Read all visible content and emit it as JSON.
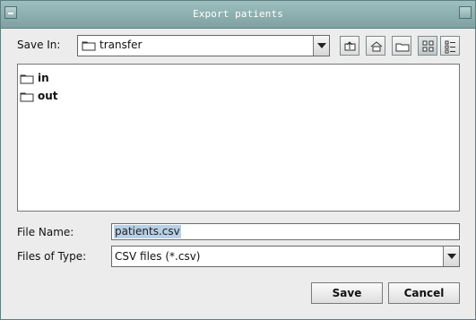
{
  "window": {
    "title": "Export patients"
  },
  "save_in": {
    "label": "Save In:",
    "value": "transfer",
    "icons": [
      "folder-icon",
      "up-one-level-icon",
      "home-icon",
      "new-folder-icon",
      "list-view-icon",
      "details-view-icon"
    ]
  },
  "file_list": [
    {
      "name": "in",
      "icon": "folder-icon"
    },
    {
      "name": "out",
      "icon": "folder-icon"
    }
  ],
  "file_name": {
    "label": "File Name:",
    "value": "patients.csv"
  },
  "files_of_type": {
    "label": "Files of Type:",
    "value": "CSV files (*.csv)"
  },
  "buttons": {
    "save": "Save",
    "cancel": "Cancel"
  },
  "colors": {
    "titlebar": "#8fb1b1",
    "dialog_bg": "#ececec",
    "selection": "#b8cfe5"
  }
}
